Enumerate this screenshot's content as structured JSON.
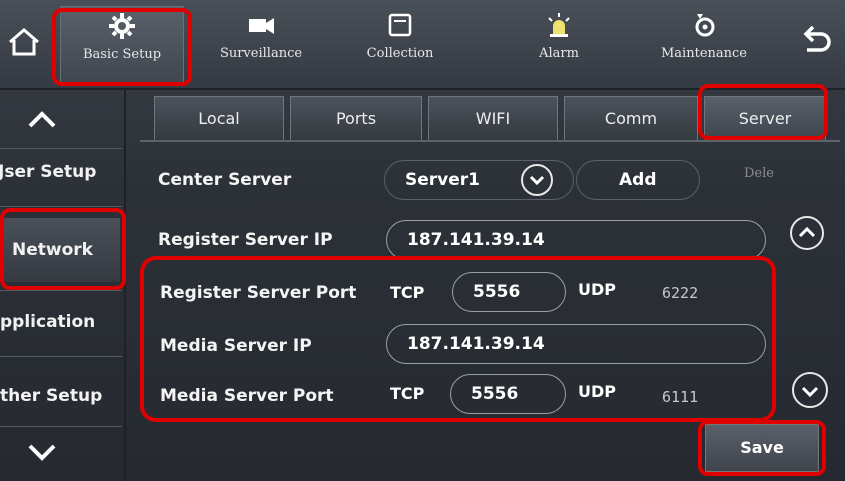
{
  "topnav": {
    "items": [
      {
        "label": "Basic Setup",
        "icon": "gear-icon",
        "active": true
      },
      {
        "label": "Surveillance",
        "icon": "camera-icon"
      },
      {
        "label": "Collection",
        "icon": "collection-icon"
      },
      {
        "label": "Alarm",
        "icon": "alarm-icon"
      },
      {
        "label": "Maintenance",
        "icon": "maintenance-icon"
      }
    ]
  },
  "subtabs": [
    {
      "label": "Local"
    },
    {
      "label": "Ports"
    },
    {
      "label": "WIFI"
    },
    {
      "label": "Comm"
    },
    {
      "label": "Server",
      "active": true
    }
  ],
  "sidebar": {
    "items": [
      {
        "label": "Jser Setup"
      },
      {
        "label": "Network",
        "active": true
      },
      {
        "label": "​pplication"
      },
      {
        "label": "ther Setup"
      }
    ]
  },
  "form": {
    "center_server": {
      "label": "Center Server",
      "value": "Server1",
      "add_label": "Add",
      "delete_label": "Dele"
    },
    "register_ip": {
      "label": "Register Server IP",
      "value": "187.141.39.14"
    },
    "register_port": {
      "label": "Register Server Port",
      "tcp_label": "TCP",
      "tcp_value": "5556",
      "udp_label": "UDP",
      "udp_value": "6222"
    },
    "media_ip": {
      "label": "Media Server IP",
      "value": "187.141.39.14"
    },
    "media_port": {
      "label": "Media Server Port",
      "tcp_label": "TCP",
      "tcp_value": "5556",
      "udp_label": "UDP",
      "udp_value": "6111"
    }
  },
  "save_label": "Save",
  "colors": {
    "highlight": "#e00000",
    "background": "#2c3037"
  }
}
